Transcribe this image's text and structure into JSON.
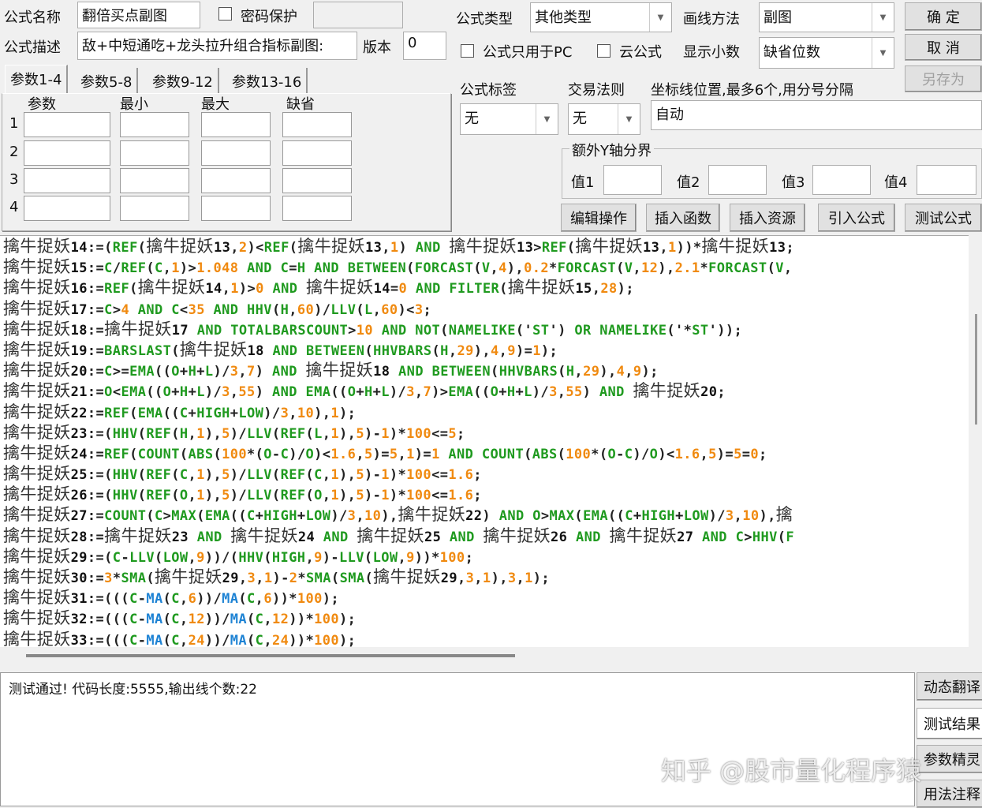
{
  "form": {
    "name_label": "公式名称",
    "name_value": "翻倍买点副图",
    "password_label": "密码保护",
    "desc_label": "公式描述",
    "desc_value": "敌+中短通吃+龙头拉升组合指标副图:",
    "version_label": "版本",
    "version_value": "0",
    "type_label": "公式类型",
    "type_value": "其他类型",
    "draw_label": "画线方法",
    "draw_value": "副图",
    "pc_only_label": "公式只用于PC",
    "cloud_label": "云公式",
    "decimal_label": "显示小数",
    "decimal_value": "缺省位数",
    "tag_label": "公式标签",
    "tag_value": "无",
    "rule_label": "交易法则",
    "rule_value": "无",
    "axis_label": "坐标线位置,最多6个,用分号分隔",
    "axis_value": "自动",
    "yaxis_group": "额外Y轴分界",
    "yvals": [
      "值1",
      "值2",
      "值3",
      "值4"
    ]
  },
  "buttons": {
    "ok": "确 定",
    "cancel": "取 消",
    "save_as": "另存为",
    "edit": "编辑操作",
    "insert_func": "插入函数",
    "insert_res": "插入资源",
    "import": "引入公式",
    "test": "测试公式",
    "translate": "动态翻译",
    "result": "测试结果",
    "wizard": "参数精灵",
    "usage": "用法注释"
  },
  "params": {
    "tabs": [
      "参数1-4",
      "参数5-8",
      "参数9-12",
      "参数13-16"
    ],
    "headers": [
      "参数",
      "最小",
      "最大",
      "缺省"
    ],
    "rows": [
      "1",
      "2",
      "3",
      "4"
    ]
  },
  "code": [
    "擒牛捉妖14:=(REF(擒牛捉妖13,2)<REF(擒牛捉妖13,1) AND 擒牛捉妖13>REF(擒牛捉妖13,1))*擒牛捉妖13;",
    "擒牛捉妖15:=C/REF(C,1)>1.048 AND C=H AND BETWEEN(FORCAST(V,4),0.2*FORCAST(V,12),2.1*FORCAST(V,",
    "擒牛捉妖16:=REF(擒牛捉妖14,1)>0 AND 擒牛捉妖14=0 AND FILTER(擒牛捉妖15,28);",
    "擒牛捉妖17:=C>4 AND C<35 AND HHV(H,60)/LLV(L,60)<3;",
    "擒牛捉妖18:=擒牛捉妖17 AND TOTALBARSCOUNT>10 AND NOT(NAMELIKE('ST') OR NAMELIKE('*ST'));",
    "擒牛捉妖19:=BARSLAST(擒牛捉妖18 AND BETWEEN(HHVBARS(H,29),4,9)=1);",
    "擒牛捉妖20:=C>=EMA((O+H+L)/3,7) AND 擒牛捉妖18 AND BETWEEN(HHVBARS(H,29),4,9);",
    "擒牛捉妖21:=O<EMA((O+H+L)/3,55) AND EMA((O+H+L)/3,7)>EMA((O+H+L)/3,55) AND 擒牛捉妖20;",
    "擒牛捉妖22:=REF(EMA((C+HIGH+LOW)/3,10),1);",
    "擒牛捉妖23:=(HHV(REF(H,1),5)/LLV(REF(L,1),5)-1)*100<=5;",
    "擒牛捉妖24:=REF(COUNT(ABS(100*(O-C)/O)<1.6,5)=5,1)=1 AND COUNT(ABS(100*(O-C)/O)<1.6,5)=5=0;",
    "擒牛捉妖25:=(HHV(REF(C,1),5)/LLV(REF(C,1),5)-1)*100<=1.6;",
    "擒牛捉妖26:=(HHV(REF(O,1),5)/LLV(REF(O,1),5)-1)*100<=1.6;",
    "擒牛捉妖27:=COUNT(C>MAX(EMA((C+HIGH+LOW)/3,10),擒牛捉妖22) AND O>MAX(EMA((C+HIGH+LOW)/3,10),擒",
    "擒牛捉妖28:=擒牛捉妖23 AND 擒牛捉妖24 AND 擒牛捉妖25 AND 擒牛捉妖26 AND 擒牛捉妖27 AND C>HHV(F",
    "擒牛捉妖29:=(C-LLV(LOW,9))/(HHV(HIGH,9)-LLV(LOW,9))*100;",
    "擒牛捉妖30:=3*SMA(擒牛捉妖29,3,1)-2*SMA(SMA(擒牛捉妖29,3,1),3,1);",
    "擒牛捉妖31:=(((C-MA(C,6))/MA(C,6))*100);",
    "擒牛捉妖32:=(((C-MA(C,12))/MA(C,12))*100);",
    "擒牛捉妖33:=(((C-MA(C,24))/MA(C,24))*100);"
  ],
  "output": {
    "message": "测试通过! 代码长度:5555,输出线个数:22"
  },
  "watermark": "知乎 @股市量化程序猿"
}
